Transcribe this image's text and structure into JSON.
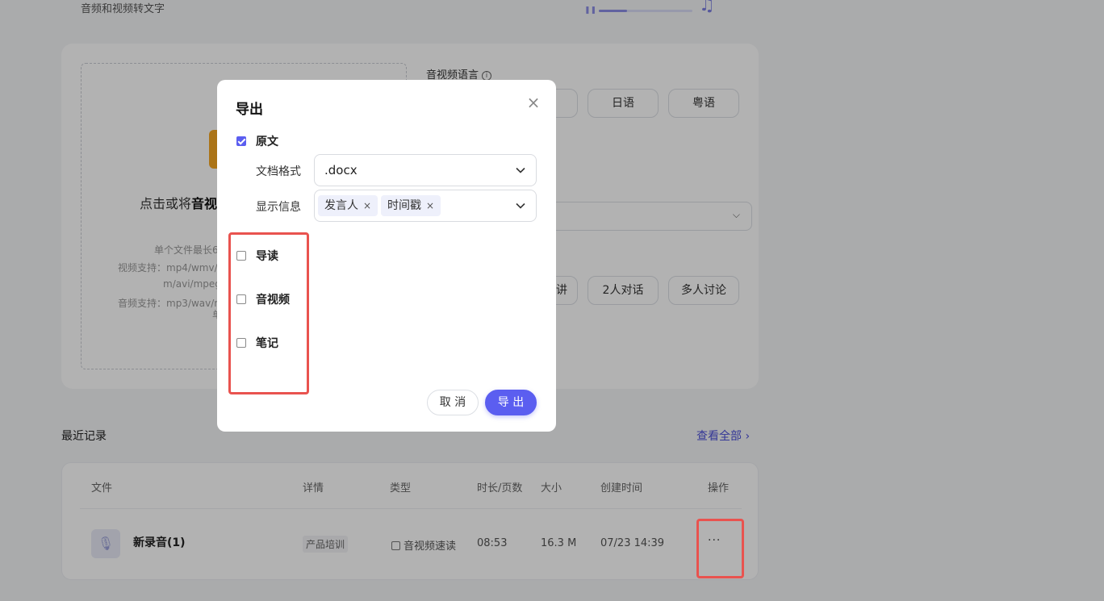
{
  "page": {
    "subtitle": "音频和视频转文字"
  },
  "upload": {
    "title_prefix": "点击或将",
    "title_bold": "音视",
    "tips": [
      "单个文件最长6",
      "视频支持：mp4/wmv/",
      "m/avi/mpeg",
      "音频支持：mp3/wav/m",
      "单"
    ]
  },
  "settings": {
    "language_label": "音视频语言",
    "language_chips": [
      "日语",
      "粤语"
    ],
    "scene_chips": [
      "讲",
      "2人对话",
      "多人讨论"
    ]
  },
  "recent": {
    "title": "最近记录",
    "view_all": "查看全部",
    "columns": [
      "文件",
      "详情",
      "类型",
      "时长/页数",
      "大小",
      "创建时间",
      "操作"
    ],
    "rows": [
      {
        "name": "新录音(1)",
        "tag": "产品培训",
        "type": "音视频速读",
        "duration": "08:53",
        "size": "16.3 M",
        "created": "07/23 14:39",
        "more": "···"
      }
    ]
  },
  "modal": {
    "title": "导出",
    "close": "×",
    "original": {
      "label": "原文",
      "checked": true
    },
    "format_label": "文档格式",
    "format_value": ".docx",
    "display_label": "显示信息",
    "display_tags": [
      "发言人",
      "时间戳"
    ],
    "tag_remove": "×",
    "extra_options": [
      {
        "label": "导读",
        "checked": false
      },
      {
        "label": "音视频",
        "checked": false
      },
      {
        "label": "笔记",
        "checked": false
      }
    ],
    "cancel": "取 消",
    "confirm": "导 出"
  },
  "colors": {
    "accent": "#5b5ef0",
    "annotation": "#e9534f",
    "overlay": "rgba(0,0,0,0.3)"
  }
}
